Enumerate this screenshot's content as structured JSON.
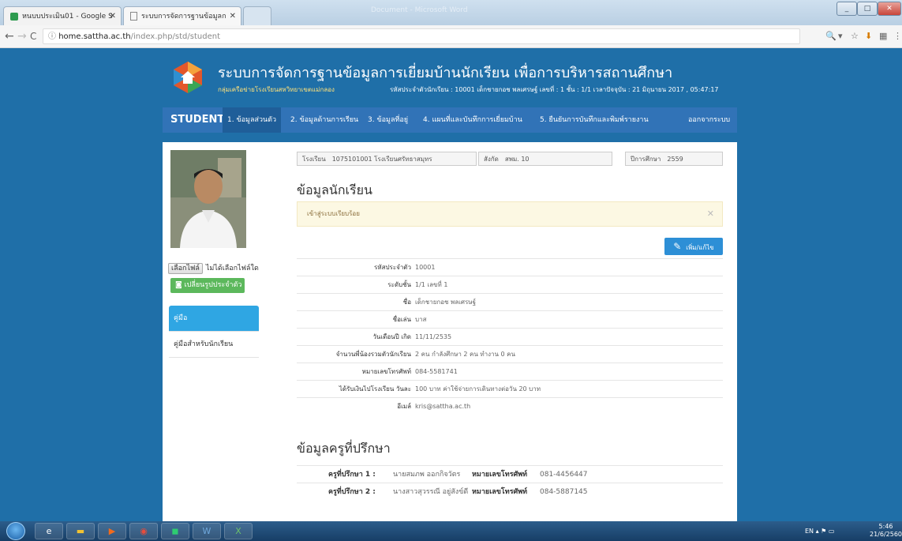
{
  "browser": {
    "tabs": [
      {
        "label": "หนบบประเมิน01 - Google S"
      },
      {
        "label": "ระบบการจัดการฐานข้อมูลก"
      }
    ],
    "url_host": "home.sattha.ac.th",
    "url_path": "/index.php/std/student",
    "window_title": "Document - Microsoft Word"
  },
  "header": {
    "title": "ระบบการจัดการฐานข้อมูลการเยี่ยมบ้านนักเรียน เพื่อการบริหารสถานศึกษา",
    "subtitle": "กลุ่มเครือข่ายโรงเรียนสหวิทยาเขตแม่กลอง",
    "info": "รหัสประจำตัวนักเรียน : 10001 เด็กชายกอช พลเศรษฐ์ เลขที่ : 1 ชั้น : 1/1 เวลาปัจจุบัน : 21 มิถุนายน 2017 , 05:47:17"
  },
  "menu": {
    "brand": "STUDENT",
    "items": [
      {
        "label": "1. ข้อมูลส่วนตัว"
      },
      {
        "label": "2. ข้อมูลด้านการเรียน"
      },
      {
        "label": "3. ข้อมูลที่อยู่"
      },
      {
        "label": "4. แผนที่และบันทึกการเยี่ยมบ้าน"
      },
      {
        "label": "5. ยืนยันการบันทึกและพิมพ์รายงาน"
      }
    ],
    "logout": "ออกจากระบบ"
  },
  "sidebar": {
    "choose_file_button": "เลือกไฟล์",
    "no_file": "ไม่ได้เลือกไฟล์ใด",
    "change_photo": "เปลี่ยนรูปประจำตัว",
    "items": [
      {
        "label": "คู่มือ"
      },
      {
        "label": "คู่มือสำหรับนักเรียน"
      }
    ]
  },
  "info_boxes": {
    "school_label": "โรงเรียน",
    "school_value": "1075101001 โรงเรียนศรัทธาสมุทร",
    "district_label": "สังกัด",
    "district_value": "สพม. 10",
    "year_label": "ปีการศึกษา",
    "year_value": "2559"
  },
  "student_section": {
    "heading": "ข้อมูลนักเรียน",
    "alert": "เข้าสู่ระบบเรียบร้อย",
    "edit_button": "เพิ่ม/แก้ไข",
    "fields": [
      {
        "label": "รหัสประจำตัว",
        "value": "10001"
      },
      {
        "label": "ระดับชั้น",
        "value": "1/1 เลขที่ 1"
      },
      {
        "label": "ชื่อ",
        "value": "เด็กชายกอช พลเศรษฐ์"
      },
      {
        "label": "ชื่อเล่น",
        "value": "บาส"
      },
      {
        "label": "วันเดือนปี เกิด",
        "value": "11/11/2535"
      },
      {
        "label": "จำนวนพี่น้องรวมตัวนักเรียน",
        "value": "2 คน   กำลังศึกษา 2 คน   ทำงาน 0 คน"
      },
      {
        "label": "หมายเลขโทรศัพท์",
        "value": "084-5581741"
      },
      {
        "label": "ได้รับเงินไปโรงเรียน วันละ",
        "value": "100 บาท   ค่าใช้จ่ายการเดินทางต่อวัน 20 บาท"
      },
      {
        "label": "อีเมล์",
        "value": "kris@sattha.ac.th"
      }
    ]
  },
  "teacher_section": {
    "heading": "ข้อมูลครูที่ปรึกษา",
    "phone_label": "หมายเลขโทรศัพท์",
    "teachers": [
      {
        "label": "ครูที่ปรึกษา 1 :",
        "name": "นายสมภพ ออกกิจวัตร",
        "phone": "081-4456447"
      },
      {
        "label": "ครูที่ปรึกษา 2 :",
        "name": "นางสาวสุวรรณี อยู่สังข์ดี",
        "phone": "084-5887145"
      }
    ]
  },
  "taskbar": {
    "lang": "EN",
    "time": "5:46",
    "date": "21/6/2560"
  }
}
